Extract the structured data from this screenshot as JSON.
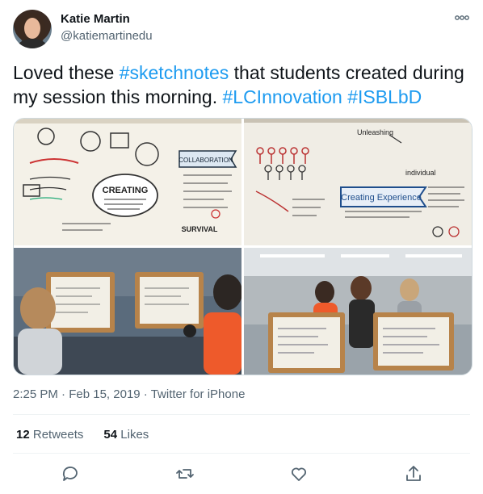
{
  "author": {
    "name": "Katie Martin",
    "handle": "@katiemartinedu"
  },
  "tweet": {
    "text_parts": [
      {
        "text": "Loved these ",
        "type": "text"
      },
      {
        "text": "#sketchnotes",
        "type": "hashtag"
      },
      {
        "text": " that students created during my session this morning. ",
        "type": "text"
      },
      {
        "text": "#LCInnovation",
        "type": "hashtag"
      },
      {
        "text": " ",
        "type": "text"
      },
      {
        "text": "#ISBLbD",
        "type": "hashtag"
      }
    ],
    "time": "2:25 PM",
    "date": "Feb 15, 2019",
    "separator": "·",
    "source": "Twitter for iPhone"
  },
  "stats": {
    "retweets_count": "12",
    "retweets_label": "Retweets",
    "likes_count": "54",
    "likes_label": "Likes"
  },
  "sketch_text": {
    "img1_collab": "COLLABORATION",
    "img1_creating": "CREATING",
    "img1_survival": "SURVIVAL",
    "img2_creating": "Creating Experience",
    "img2_unleash": "Unleashing",
    "img2_individual": "individual"
  },
  "colors": {
    "hashtag": "#1d9bf0",
    "text": "#0f1419",
    "secondary": "#536471",
    "border": "#cfd9de"
  },
  "icons": [
    "more-icon",
    "reply-icon",
    "retweet-icon",
    "like-icon",
    "share-icon"
  ]
}
